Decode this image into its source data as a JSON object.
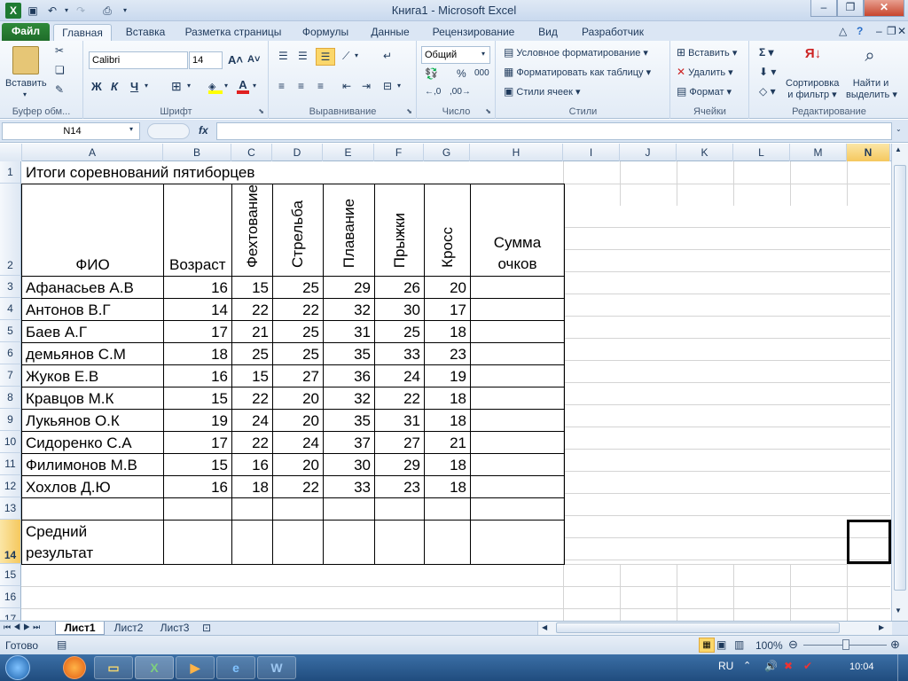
{
  "window": {
    "title": "Книга1  -  Microsoft Excel"
  },
  "tabs": {
    "file": "Файл",
    "home": "Главная",
    "insert": "Вставка",
    "layout": "Разметка страницы",
    "formulas": "Формулы",
    "data": "Данные",
    "review": "Рецензирование",
    "view": "Вид",
    "developer": "Разработчик"
  },
  "ribbon": {
    "clipboard": {
      "paste": "Вставить",
      "label": "Буфер обм..."
    },
    "font": {
      "name": "Calibri",
      "size": "14",
      "bold": "Ж",
      "italic": "К",
      "underline": "Ч",
      "label": "Шрифт"
    },
    "alignment": {
      "label": "Выравнивание"
    },
    "number": {
      "format": "Общий",
      "percent": "%",
      "thousands": "000",
      "label": "Число"
    },
    "styles": {
      "conditional": "Условное форматирование",
      "as_table": "Форматировать как таблицу",
      "cell_styles": "Стили ячеек",
      "label": "Стили"
    },
    "cells": {
      "insert": "Вставить",
      "delete": "Удалить",
      "format": "Формат",
      "label": "Ячейки"
    },
    "editing": {
      "sort_line1": "Сортировка",
      "sort_line2": "и фильтр",
      "find_line1": "Найти и",
      "find_line2": "выделить",
      "label": "Редактирование"
    }
  },
  "formula_bar": {
    "name_box": "N14",
    "fx": "fx",
    "formula": ""
  },
  "columns": [
    "A",
    "B",
    "C",
    "D",
    "E",
    "F",
    "G",
    "H",
    "I",
    "J",
    "K",
    "L",
    "M",
    "N"
  ],
  "rows": [
    "1",
    "2",
    "3",
    "4",
    "5",
    "6",
    "7",
    "8",
    "9",
    "10",
    "11",
    "12",
    "13",
    "14",
    "15",
    "16",
    "17"
  ],
  "sheet": {
    "title": "Итоги соревнований пятиборцев",
    "headers": {
      "name": "ФИО",
      "age": "Возраст",
      "fencing": "Фехтование",
      "shooting": "Стрельба",
      "swimming": "Плавание",
      "jumping": "Прыжки",
      "cross": "Кросс",
      "sum_line1": "Сумма",
      "sum_line2": "очков"
    },
    "athletes": [
      {
        "name": "Афанасьев А.В",
        "age": "16",
        "c": "15",
        "d": "25",
        "e": "29",
        "f": "26",
        "g": "20"
      },
      {
        "name": "Антонов В.Г",
        "age": "14",
        "c": "22",
        "d": "22",
        "e": "32",
        "f": "30",
        "g": "17"
      },
      {
        "name": "Баев А.Г",
        "age": "17",
        "c": "21",
        "d": "25",
        "e": "31",
        "f": "25",
        "g": "18"
      },
      {
        "name": "демьянов С.М",
        "age": "18",
        "c": "25",
        "d": "25",
        "e": "35",
        "f": "33",
        "g": "23"
      },
      {
        "name": "Жуков Е.В",
        "age": "16",
        "c": "15",
        "d": "27",
        "e": "36",
        "f": "24",
        "g": "19"
      },
      {
        "name": "Кравцов М.К",
        "age": "15",
        "c": "22",
        "d": "20",
        "e": "32",
        "f": "22",
        "g": "18"
      },
      {
        "name": "Лукьянов О.К",
        "age": "19",
        "c": "24",
        "d": "20",
        "e": "35",
        "f": "31",
        "g": "18"
      },
      {
        "name": "Сидоренко С.А",
        "age": "17",
        "c": "22",
        "d": "24",
        "e": "37",
        "f": "27",
        "g": "21"
      },
      {
        "name": "Филимонов М.В",
        "age": "15",
        "c": "16",
        "d": "20",
        "e": "30",
        "f": "29",
        "g": "18"
      },
      {
        "name": "Хохлов Д.Ю",
        "age": "16",
        "c": "18",
        "d": "22",
        "e": "33",
        "f": "23",
        "g": "18"
      }
    ],
    "avg_line1": "Средний",
    "avg_line2": "результат"
  },
  "sheet_tabs": [
    "Лист1",
    "Лист2",
    "Лист3"
  ],
  "status": {
    "ready": "Готово",
    "zoom": "100%"
  },
  "taskbar": {
    "lang": "RU",
    "time": "10:04"
  }
}
